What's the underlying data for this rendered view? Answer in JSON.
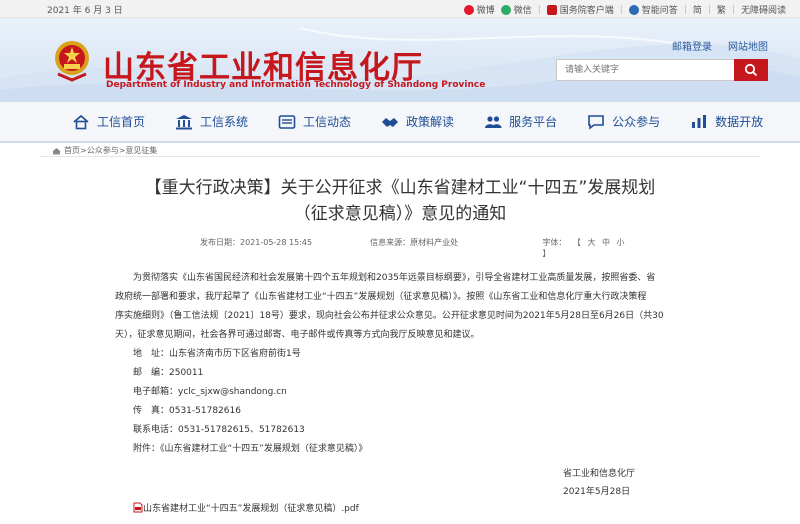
{
  "topbar": {
    "date": "2021 年 6 月 3 日",
    "links": [
      {
        "label": "微博",
        "icon": "weibo-icon",
        "color": "#e6162d"
      },
      {
        "label": "微信",
        "icon": "wechat-icon",
        "color": "#2aae67"
      },
      {
        "label": "国务院客户端",
        "icon": "state-council-app-icon",
        "color": "#c6171d"
      },
      {
        "label": "智能问答",
        "icon": "chat-robot-icon",
        "color": "#2d6bb5"
      },
      {
        "label": "简",
        "icon": "",
        "color": ""
      },
      {
        "label": "繁",
        "icon": "",
        "color": ""
      },
      {
        "label": "无障碍阅读",
        "icon": "",
        "color": ""
      }
    ]
  },
  "header": {
    "title": "山东省工业和信息化厅",
    "subtitle": "Department of Industry and Information Technology of Shandong Province",
    "email_login": "邮箱登录",
    "sitemap": "网站地图",
    "search_placeholder": "请输入关键字",
    "brand_color": "#c6171d"
  },
  "nav": [
    {
      "label": "工信首页",
      "icon": "home-icon"
    },
    {
      "label": "工信系统",
      "icon": "building-icon"
    },
    {
      "label": "工信动态",
      "icon": "news-icon"
    },
    {
      "label": "政策解读",
      "icon": "handshake-icon"
    },
    {
      "label": "服务平台",
      "icon": "people-icon"
    },
    {
      "label": "公众参与",
      "icon": "chat-icon"
    },
    {
      "label": "数据开放",
      "icon": "data-icon"
    }
  ],
  "breadcrumb": "首页>公众参与>意见征集",
  "article": {
    "title_line1": "【重大行政决策】关于公开征求《山东省建材工业“十四五”发展规划",
    "title_line2": "（征求意见稿）》意见的通知",
    "published": "发布日期：2021-05-28 15:45",
    "source": "信息来源：原材料产业处",
    "font_label": "字体：",
    "font_sizes": [
      "【",
      "大",
      "中",
      "小",
      "】"
    ],
    "lines": [
      "为贯彻落实《山东省国民经济和社会发展第十四个五年规划和2035年远景目标纲要》，引导全省建材工业高质量发展，按照省委、省",
      "政府统一部署和要求，我厅起草了《山东省建材工业“十四五”发展规划（征求意见稿）》。按照《山东省工业和信息化厅重大行政决策程",
      "序实施细则》（鲁工信法规〔2021〕18号）要求，现向社会公布并征求公众意见。公开征求意见时间为2021年5月28日至6月26日（共30",
      "天），征求意见期间，社会各界可通过邮寄、电子邮件或传真等方式向我厅反映意见和建议。"
    ],
    "address": "地　址：山东省济南市历下区省府前街1号",
    "postcode": "邮　编：250011",
    "email": "电子邮箱：yclc_sjxw@shandong.cn",
    "fax": "传　真：0531-51782616",
    "phone": "联系电话：0531-51782615、51782613",
    "annex": "附件：《山东省建材工业“十四五”发展规划（征求意见稿）》",
    "sign_org": "省工业和信息化厅",
    "sign_date": "2021年5月28日",
    "attachment": "山东省建材工业“十四五”发展规划（征求意见稿）.pdf"
  }
}
